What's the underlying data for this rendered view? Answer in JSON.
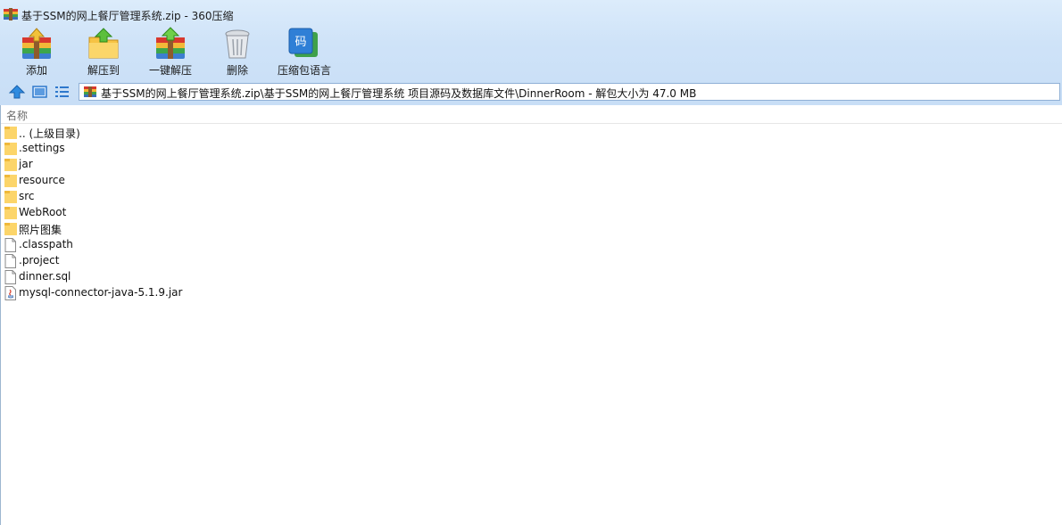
{
  "window": {
    "title": "基于SSM的网上餐厅管理系统.zip - 360压缩",
    "app_icon": "archive-icon"
  },
  "toolbar": {
    "buttons": [
      {
        "label": "添加",
        "icon": "add-archive-icon"
      },
      {
        "label": "解压到",
        "icon": "extract-to-icon"
      },
      {
        "label": "一键解压",
        "icon": "one-click-extract-icon"
      },
      {
        "label": "删除",
        "icon": "trash-icon"
      },
      {
        "label": "压缩包语言",
        "icon": "encoding-icon",
        "icon_text": "码"
      }
    ]
  },
  "address": {
    "path": "基于SSM的网上餐厅管理系统.zip\\基于SSM的网上餐厅管理系统 项目源码及数据库文件\\DinnerRoom - 解包大小为 47.0 MB"
  },
  "list": {
    "column_name": "名称",
    "items": [
      {
        "name": ".. (上级目录)",
        "type": "folder"
      },
      {
        "name": ".settings",
        "type": "folder"
      },
      {
        "name": "jar",
        "type": "folder"
      },
      {
        "name": "resource",
        "type": "folder"
      },
      {
        "name": "src",
        "type": "folder"
      },
      {
        "name": "WebRoot",
        "type": "folder"
      },
      {
        "name": "照片图集",
        "type": "folder"
      },
      {
        "name": ".classpath",
        "type": "file"
      },
      {
        "name": ".project",
        "type": "file"
      },
      {
        "name": "dinner.sql",
        "type": "file"
      },
      {
        "name": "mysql-connector-java-5.1.9.jar",
        "type": "jar"
      }
    ]
  }
}
